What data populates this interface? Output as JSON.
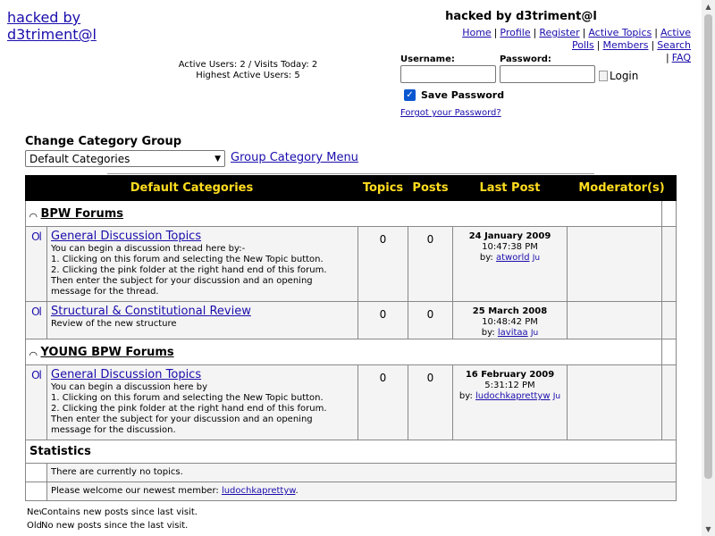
{
  "header": {
    "logo_alt": "hacked by d3triment@l",
    "site_title": "hacked by d3triment@l",
    "nav": [
      "Home",
      "Profile",
      "Register",
      "Active Topics",
      "Active Polls",
      "Members",
      "Search",
      "FAQ"
    ],
    "active_users_line1": "Active Users: 2 / Visits Today: 2",
    "active_users_line2": "Highest Active Users: 5"
  },
  "login": {
    "username_label": "Username:",
    "password_label": "Password:",
    "username_value": "",
    "password_value": "",
    "login_alt": "Login",
    "save_password_label": "Save Password",
    "save_password_checked": true,
    "forgot_link": "Forgot your Password?"
  },
  "category_group": {
    "label": "Change Category Group",
    "selected": "Default Categories",
    "menu_link": "Group Category Menu"
  },
  "table": {
    "headers": {
      "categories": "Default Categories",
      "topics": "Topics",
      "posts": "Posts",
      "last_post": "Last Post",
      "moderators": "Moderator(s)"
    },
    "categories": [
      {
        "name": "BPW Forums",
        "forums": [
          {
            "title": "General Discussion Topics",
            "description": [
              "You can begin a discussion thread here by:-",
              "1. Clicking on this forum and selecting the New Topic button.",
              "2. Clicking the pink folder at the right hand end of this forum.",
              "Then enter the subject for your discussion and an opening",
              "message for the thread."
            ],
            "topics": "0",
            "posts": "0",
            "last_date": "24 January 2009",
            "last_time": "10:47:38 PM",
            "by_label": "by:",
            "by_user": "atworld",
            "jump": "Ju"
          },
          {
            "title": "Structural & Constitutional Review",
            "description": [
              "Review of the new structure"
            ],
            "topics": "0",
            "posts": "0",
            "last_date": "25 March 2008",
            "last_time": "10:48:42 PM",
            "by_label": "by:",
            "by_user": "lavitaa",
            "jump": "Ju"
          }
        ]
      },
      {
        "name": "YOUNG BPW Forums",
        "forums": [
          {
            "title": "General Discussion Topics",
            "description": [
              "You can begin a discussion here by",
              "1. Clicking on this forum and selecting the New Topic button.",
              "2. Clicking the pink folder at the right hand end of this forum.",
              "Then enter the subject for your discussion and an opening",
              "message for the discussion."
            ],
            "topics": "0",
            "posts": "0",
            "last_date": "16 February 2009",
            "last_time": "5:31:12 PM",
            "by_label": "by:",
            "by_user": "ludochkaprettyw",
            "jump": "Ju"
          }
        ]
      }
    ]
  },
  "statistics": {
    "title": "Statistics",
    "no_topics": "There are currently no topics.",
    "welcome_prefix": "Please welcome our newest member:",
    "newest_member": "ludochkaprettyw",
    "welcome_suffix": "."
  },
  "legend": {
    "new_icon": "New",
    "new_text": "Contains new posts since last visit.",
    "old_icon": "Old",
    "old_text": "No new posts since the last visit."
  },
  "icons": {
    "category_toggle": "collapse-icon",
    "forum_folder": "folder-icon"
  }
}
